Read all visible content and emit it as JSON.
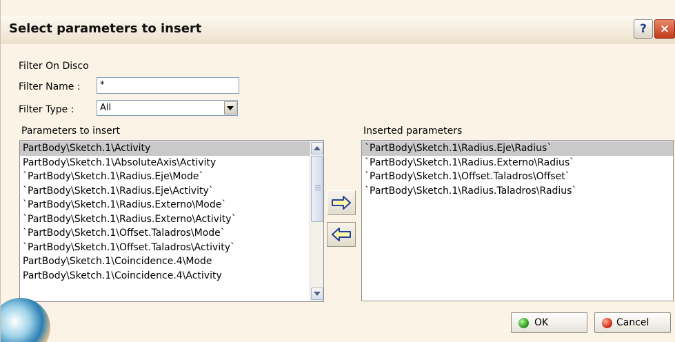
{
  "dialog": {
    "title": "Select parameters to insert",
    "help_glyph": "?",
    "close_glyph": "×"
  },
  "filter": {
    "group_label": "Filter On Disco",
    "name_label": "Filter Name :",
    "name_value": "*",
    "type_label": "Filter Type :",
    "type_value": "All"
  },
  "lists": {
    "available_label": "Parameters to insert",
    "available_items": [
      "PartBody\\Sketch.1\\Activity",
      "PartBody\\Sketch.1\\AbsoluteAxis\\Activity",
      "`PartBody\\Sketch.1\\Radius.Eje\\Mode`",
      "`PartBody\\Sketch.1\\Radius.Eje\\Activity`",
      "`PartBody\\Sketch.1\\Radius.Externo\\Mode`",
      "`PartBody\\Sketch.1\\Radius.Externo\\Activity`",
      "`PartBody\\Sketch.1\\Offset.Taladros\\Mode`",
      "`PartBody\\Sketch.1\\Offset.Taladros\\Activity`",
      "PartBody\\Sketch.1\\Coincidence.4\\Mode",
      "PartBody\\Sketch.1\\Coincidence.4\\Activity"
    ],
    "inserted_label": "Inserted parameters",
    "inserted_items": [
      "`PartBody\\Sketch.1\\Radius.Eje\\Radius`",
      "`PartBody\\Sketch.1\\Radius.Externo\\Radius`",
      "`PartBody\\Sketch.1\\Offset.Taladros\\Offset`",
      "`PartBody\\Sketch.1\\Radius.Taladros\\Radius`"
    ]
  },
  "buttons": {
    "ok_label": "OK",
    "cancel_label": "Cancel"
  },
  "icons": {
    "insert": "arrow-right-icon",
    "remove": "arrow-left-icon",
    "ok": "green-dot-icon",
    "cancel": "red-dot-icon"
  },
  "colors": {
    "dialog_bg": "#fbf4e6",
    "selection": "#c9c9c9",
    "arrow_fill": "#fff9a8",
    "arrow_stroke": "#1e3fa0"
  }
}
